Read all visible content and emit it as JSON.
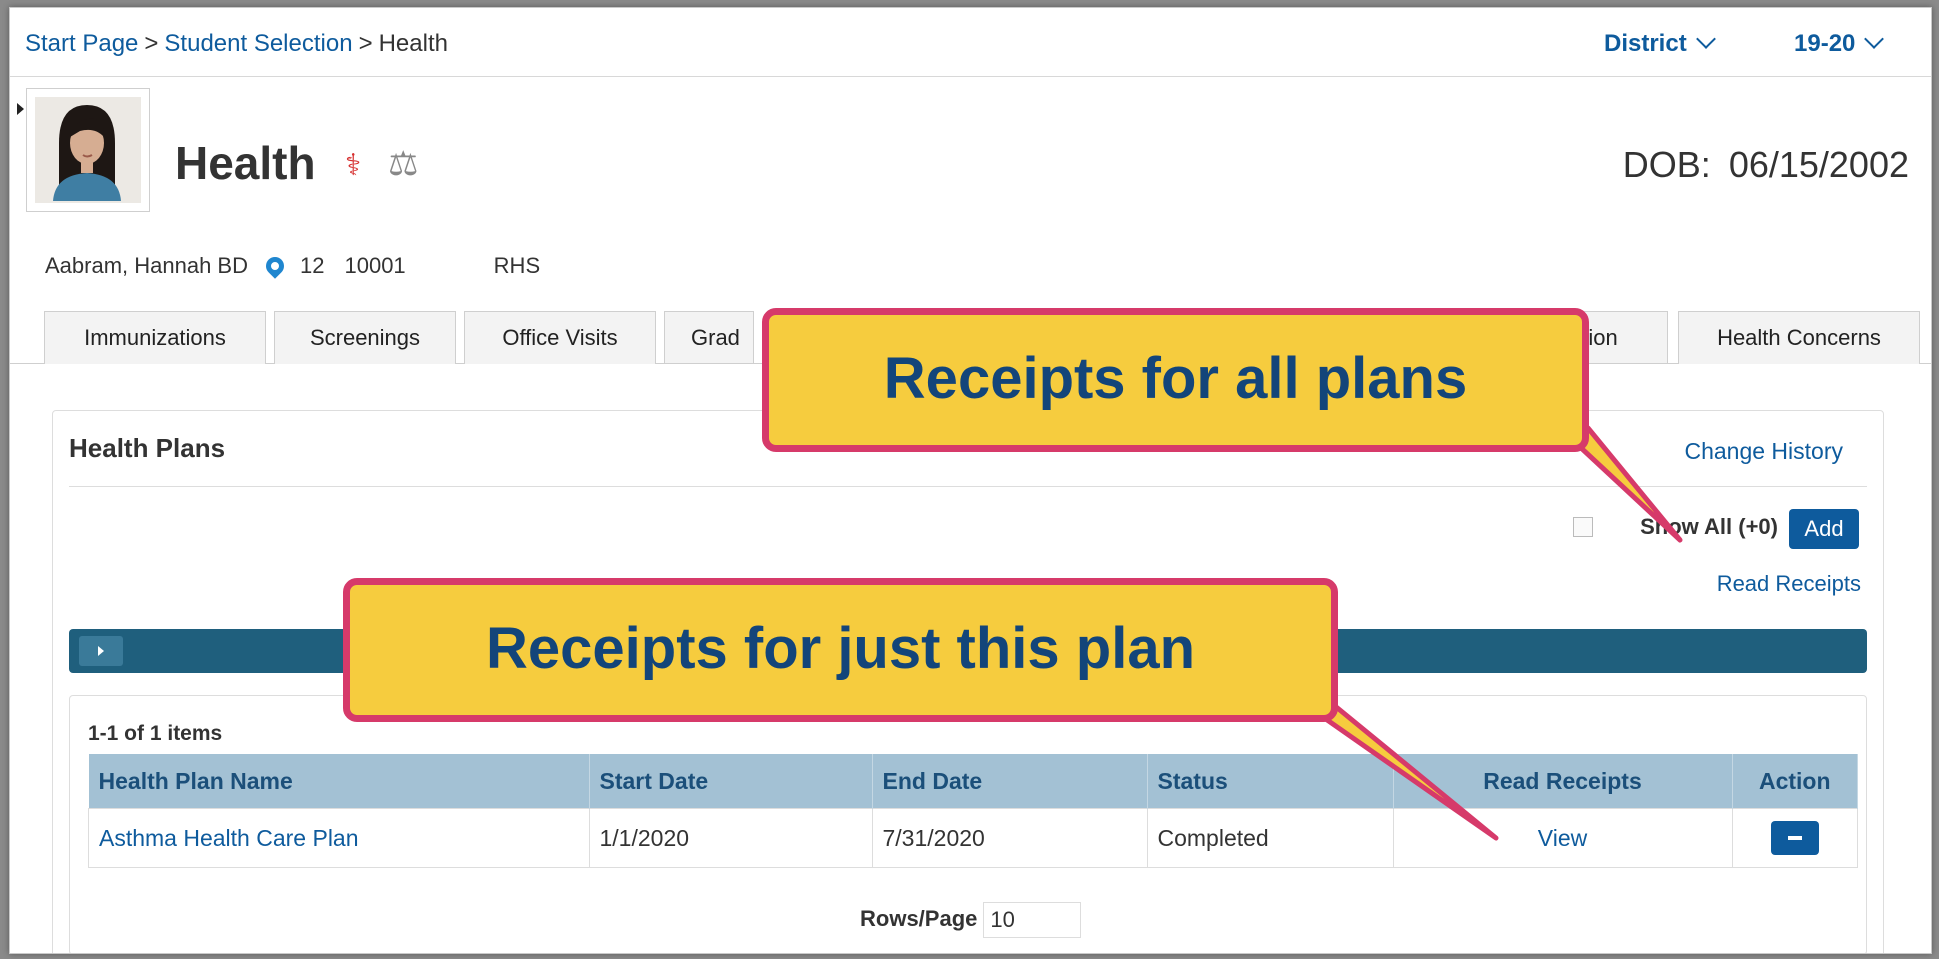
{
  "breadcrumb": [
    {
      "label": "Start Page",
      "link": true
    },
    {
      "label": "Student Selection",
      "link": true
    },
    {
      "label": "Health",
      "link": false
    }
  ],
  "selectors": {
    "district": "District",
    "year": "19-20"
  },
  "header": {
    "title": "Health",
    "dob_label": "DOB:",
    "dob_value": "06/15/2002"
  },
  "student": {
    "name": "Aabram, Hannah BD",
    "grade": "12",
    "id": "10001",
    "school": "RHS"
  },
  "tabs": [
    "Immunizations",
    "Screenings",
    "Office Visits",
    "Grad",
    "cation",
    "Health Concerns"
  ],
  "panel": {
    "title": "Health Plans",
    "change_history": "Change History",
    "show_all": "Show All (+0)",
    "add": "Add",
    "read_receipts": "Read Receipts",
    "count": "1-1 of 1 items",
    "rows_per_page_label": "Rows/Page",
    "rows_per_page_value": "10"
  },
  "table": {
    "headers": [
      "Health Plan Name",
      "Start Date",
      "End Date",
      "Status",
      "Read Receipts",
      "Action"
    ],
    "rows": [
      {
        "name": "Asthma Health Care Plan",
        "start": "1/1/2020",
        "end": "7/31/2020",
        "status": "Completed",
        "receipts": "View"
      }
    ]
  },
  "callouts": {
    "all_plans": "Receipts for all plans",
    "this_plan": "Receipts for just this plan"
  },
  "colors": {
    "link": "#0e5b9d",
    "callout_fill": "#f6cc3e",
    "callout_border": "#d63a6a",
    "header_bar": "#1f5f7d"
  }
}
